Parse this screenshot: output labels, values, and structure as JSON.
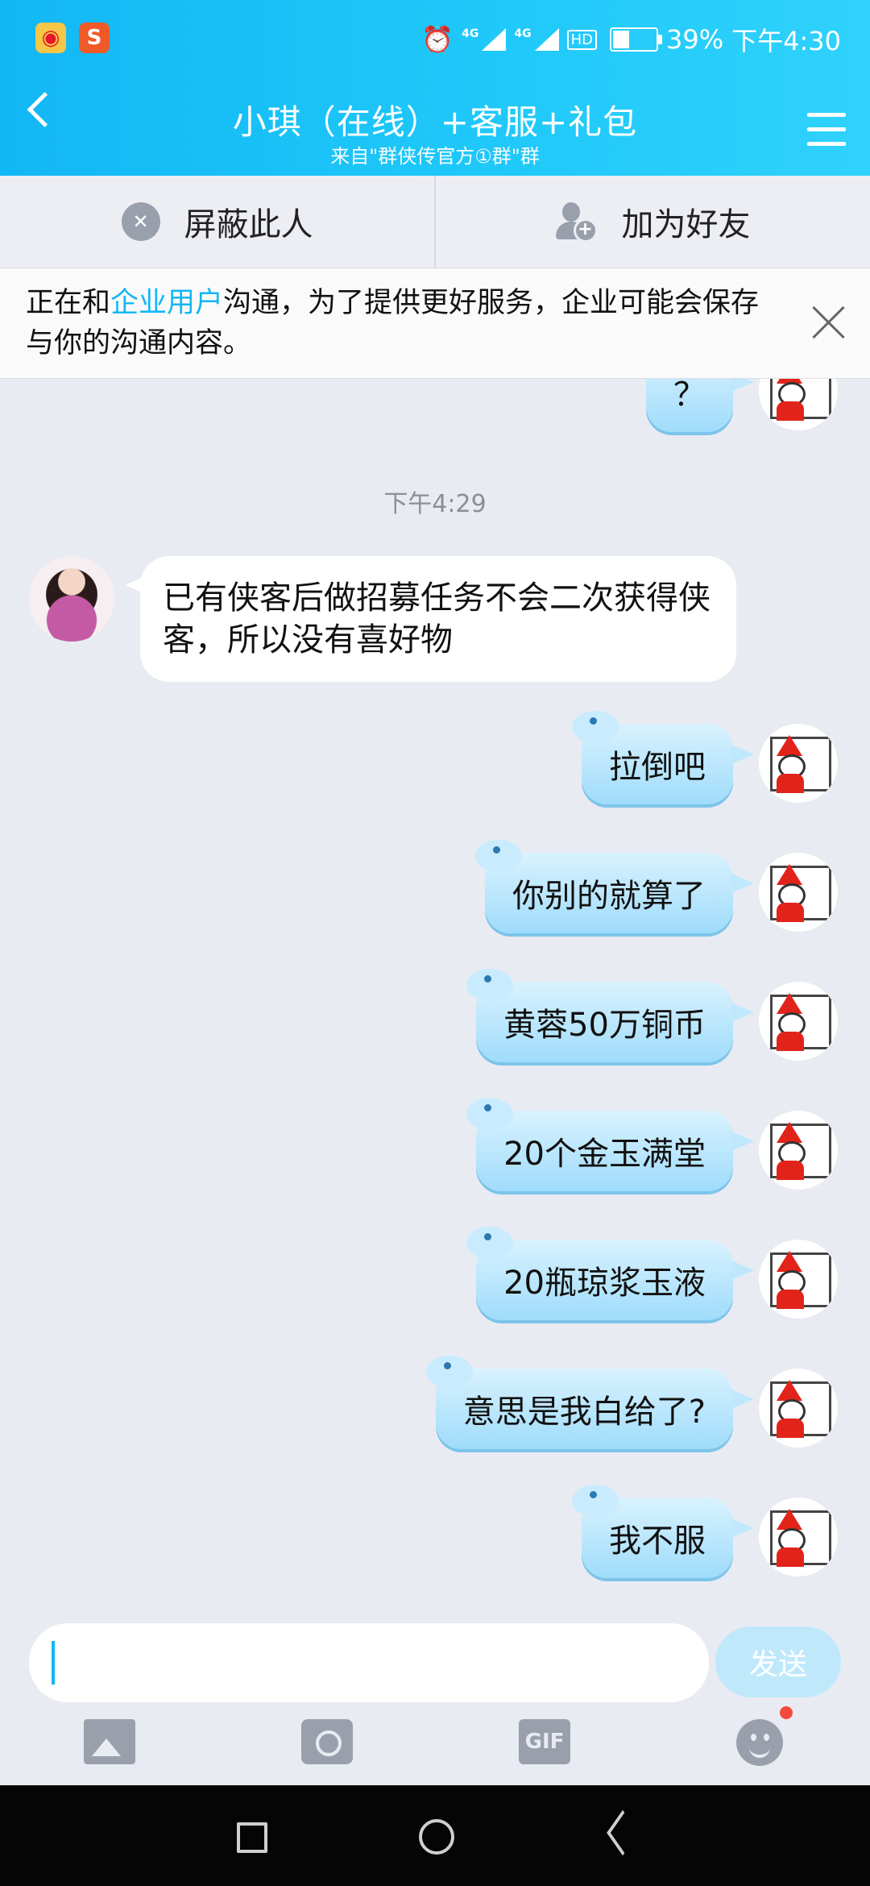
{
  "status_bar": {
    "network_1": "4G",
    "network_2": "4G",
    "hd": "HD",
    "battery_percent": "39%",
    "battery_level": 0.39,
    "time": "下午4:30"
  },
  "header": {
    "title": "小琪（在线）+客服+礼包",
    "subtitle": "来自\"群侠传官方①群\"群"
  },
  "actions": {
    "block_label": "屏蔽此人",
    "add_friend_label": "加为好友"
  },
  "notice": {
    "prefix": "正在和",
    "link": "企业用户",
    "suffix": "沟通，为了提供更好服务，企业可能会保存与你的沟通内容。"
  },
  "chat": {
    "partial_message": "？",
    "timestamp": "下午4:29",
    "received_message": "已有侠客后做招募任务不会二次获得侠客，所以没有喜好物",
    "sent_messages": [
      "拉倒吧",
      "你别的就算了",
      "黄蓉50万铜币",
      "20个金玉满堂",
      "20瓶琼浆玉液",
      "意思是我白给了?",
      "我不服"
    ]
  },
  "input": {
    "placeholder": "",
    "send_label": "发送"
  },
  "toolbar": {
    "gif_label": "GIF"
  },
  "colors": {
    "brand": "#12b7f5",
    "bubble": "#a8dffb",
    "badge": "#f34a3d"
  }
}
